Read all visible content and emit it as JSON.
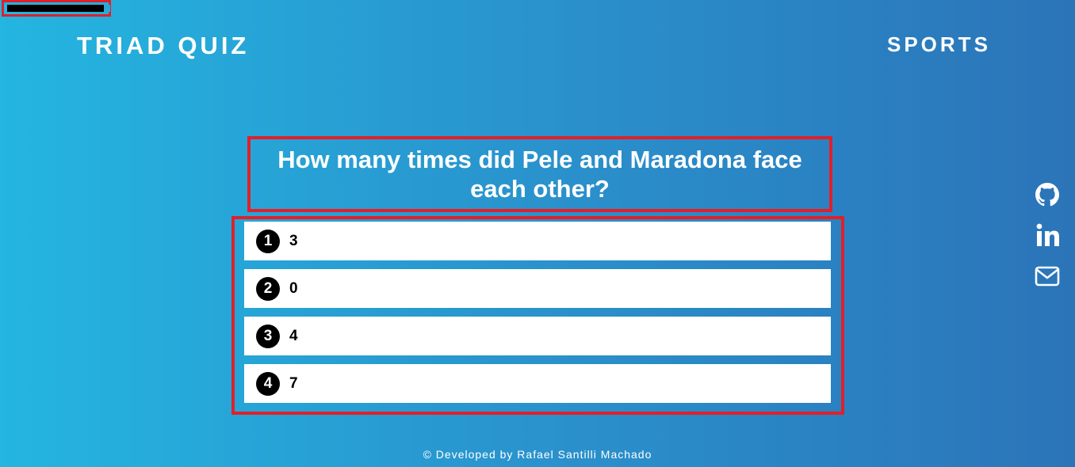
{
  "header": {
    "brand": "TRIAD QUIZ",
    "category": "SPORTS"
  },
  "timer": {
    "remaining_fraction": 0.97
  },
  "question": {
    "text": "How many times did Pele and Maradona face each other?"
  },
  "answers": [
    {
      "number": "1",
      "label": "3"
    },
    {
      "number": "2",
      "label": "0"
    },
    {
      "number": "3",
      "label": "4"
    },
    {
      "number": "4",
      "label": "7"
    }
  ],
  "social": [
    {
      "icon": "github-icon"
    },
    {
      "icon": "linkedin-icon"
    },
    {
      "icon": "mail-icon"
    }
  ],
  "footer": {
    "text": "© Developed by Rafael Santilli Machado"
  },
  "colors": {
    "highlight_border": "#e0202a",
    "background_start": "#24b5e0",
    "background_end": "#2b74b8"
  }
}
